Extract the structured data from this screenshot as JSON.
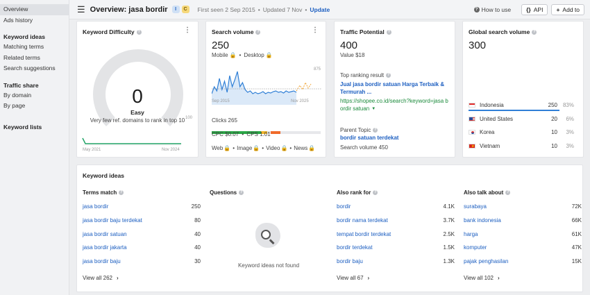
{
  "sidebar": {
    "items": [
      {
        "label": "Overview",
        "active": true
      },
      {
        "label": "Ads history"
      }
    ],
    "sections": [
      {
        "heading": "Keyword ideas",
        "items": [
          "Matching terms",
          "Related terms",
          "Search suggestions"
        ]
      },
      {
        "heading": "Traffic share",
        "items": [
          "By domain",
          "By page"
        ]
      },
      {
        "heading": "Keyword lists",
        "items": []
      }
    ]
  },
  "header": {
    "title": "Overview: jasa bordir",
    "badge_i": "I",
    "badge_c": "C",
    "first_seen": "First seen 2 Sep 2015",
    "updated": "Updated 7 Nov",
    "update_label": "Update",
    "how_to": "How to use",
    "api_label": "API",
    "add_label": "Add to"
  },
  "kd": {
    "title": "Keyword Difficulty",
    "value": "0",
    "level": "Easy",
    "desc": "Very few ref. domains to rank in top 10",
    "axis_max": "100",
    "date_start": "May 2021",
    "date_end": "Nov 2024",
    "gauge_color": "#e3e4e6",
    "line_color": "#21a366"
  },
  "volume": {
    "title": "Search volume",
    "value": "250",
    "mobile": "Mobile",
    "desktop": "Desktop",
    "axis_max": "875",
    "date_start": "Sep 2015",
    "date_end": "Nov 2025",
    "clicks": "Clicks 265",
    "cpc": "CPC $0.07",
    "cps": "CPS 1.01",
    "serp": [
      "Web",
      "Image",
      "Video",
      "News"
    ],
    "bar_segments": [
      {
        "share": 0.45,
        "color": "#29a745"
      },
      {
        "share": 0.06,
        "color": "#f0b429"
      },
      {
        "share": 0.03,
        "color": "#e7e8eb"
      },
      {
        "share": 0.09,
        "color": "#f06a2a"
      },
      {
        "share": 0.37,
        "color": "#e7e8eb"
      }
    ],
    "line_color": "#2f7fd6",
    "forecast_color": "#f0a230"
  },
  "traffic": {
    "title": "Traffic Potential",
    "value": "400",
    "value_line": "Value $18",
    "top_label": "Top ranking result",
    "top_title_line1": "Jual jasa bordir satuan Harga Terbaik &",
    "top_title_line2": "Termurah ...",
    "top_url_line1": "https://shopee.co.id/search?keyword=jasa b",
    "top_url_line2": "ordir satuan",
    "parent_label": "Parent Topic",
    "parent_topic": "bordir satuan terdekat",
    "parent_volume": "Search volume 450"
  },
  "global": {
    "title": "Global search volume",
    "value": "300",
    "countries": [
      {
        "name": "Indonesia",
        "volume": "250",
        "share": "83%",
        "fraction": 0.83,
        "flag": "id"
      },
      {
        "name": "United States",
        "volume": "20",
        "share": "6%",
        "fraction": 0.06,
        "flag": "us"
      },
      {
        "name": "Korea",
        "volume": "10",
        "share": "3%",
        "fraction": 0.03,
        "flag": "kr"
      },
      {
        "name": "Vietnam",
        "volume": "10",
        "share": "3%",
        "fraction": 0.03,
        "flag": "vn"
      }
    ],
    "bar_color": "#2f7fd6"
  },
  "ideas": {
    "title": "Keyword ideas",
    "columns": [
      {
        "heading": "Terms match",
        "rows": [
          {
            "kw": "jasa bordir",
            "v": "250"
          },
          {
            "kw": "jasa bordir baju terdekat",
            "v": "80"
          },
          {
            "kw": "jasa bordir satuan",
            "v": "40"
          },
          {
            "kw": "jasa bordir jakarta",
            "v": "40"
          },
          {
            "kw": "jasa bordir baju",
            "v": "30"
          }
        ],
        "view_all": "View all 262"
      },
      {
        "heading": "Questions",
        "rows": [],
        "empty": "Keyword ideas not found"
      },
      {
        "heading": "Also rank for",
        "rows": [
          {
            "kw": "bordir",
            "v": "4.1K"
          },
          {
            "kw": "bordir nama terdekat",
            "v": "3.7K"
          },
          {
            "kw": "tempat bordir terdekat",
            "v": "2.5K"
          },
          {
            "kw": "bordir terdekat",
            "v": "1.5K"
          },
          {
            "kw": "bordir baju",
            "v": "1.3K"
          }
        ],
        "view_all": "View all 67"
      },
      {
        "heading": "Also talk about",
        "rows": [
          {
            "kw": "surabaya",
            "v": "72K"
          },
          {
            "kw": "bank indonesia",
            "v": "66K"
          },
          {
            "kw": "harga",
            "v": "61K"
          },
          {
            "kw": "komputer",
            "v": "47K"
          },
          {
            "kw": "pajak penghasilan",
            "v": "15K"
          }
        ],
        "view_all": "View all 102"
      }
    ]
  }
}
